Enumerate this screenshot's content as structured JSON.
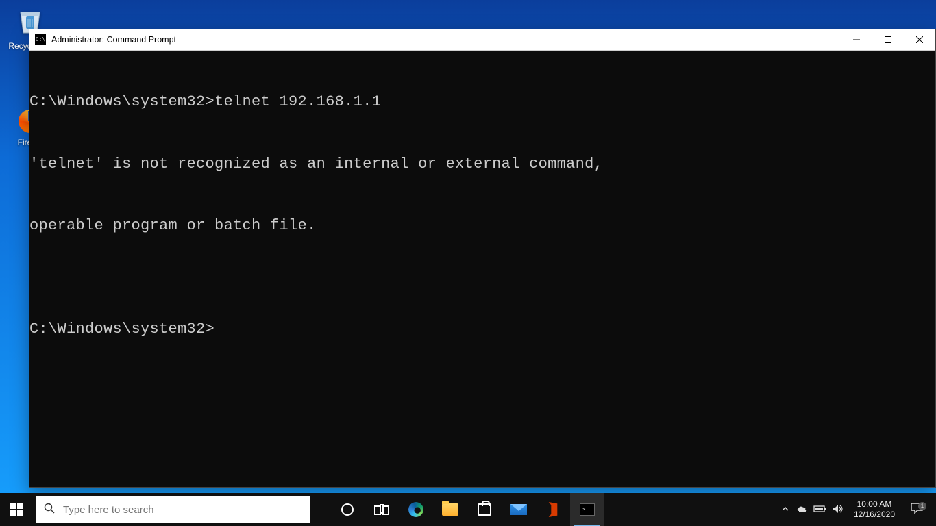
{
  "desktop": {
    "icons": [
      {
        "label": "Recycle Bin"
      },
      {
        "label": "Firefox"
      }
    ]
  },
  "window": {
    "title": "Administrator: Command Prompt",
    "terminal_lines": [
      "C:\\Windows\\system32>telnet 192.168.1.1",
      "'telnet' is not recognized as an internal or external command,",
      "operable program or batch file.",
      "",
      "C:\\Windows\\system32>"
    ]
  },
  "taskbar": {
    "search_placeholder": "Type here to search",
    "clock_time": "10:00 AM",
    "clock_date": "12/16/2020",
    "notification_count": "1"
  }
}
